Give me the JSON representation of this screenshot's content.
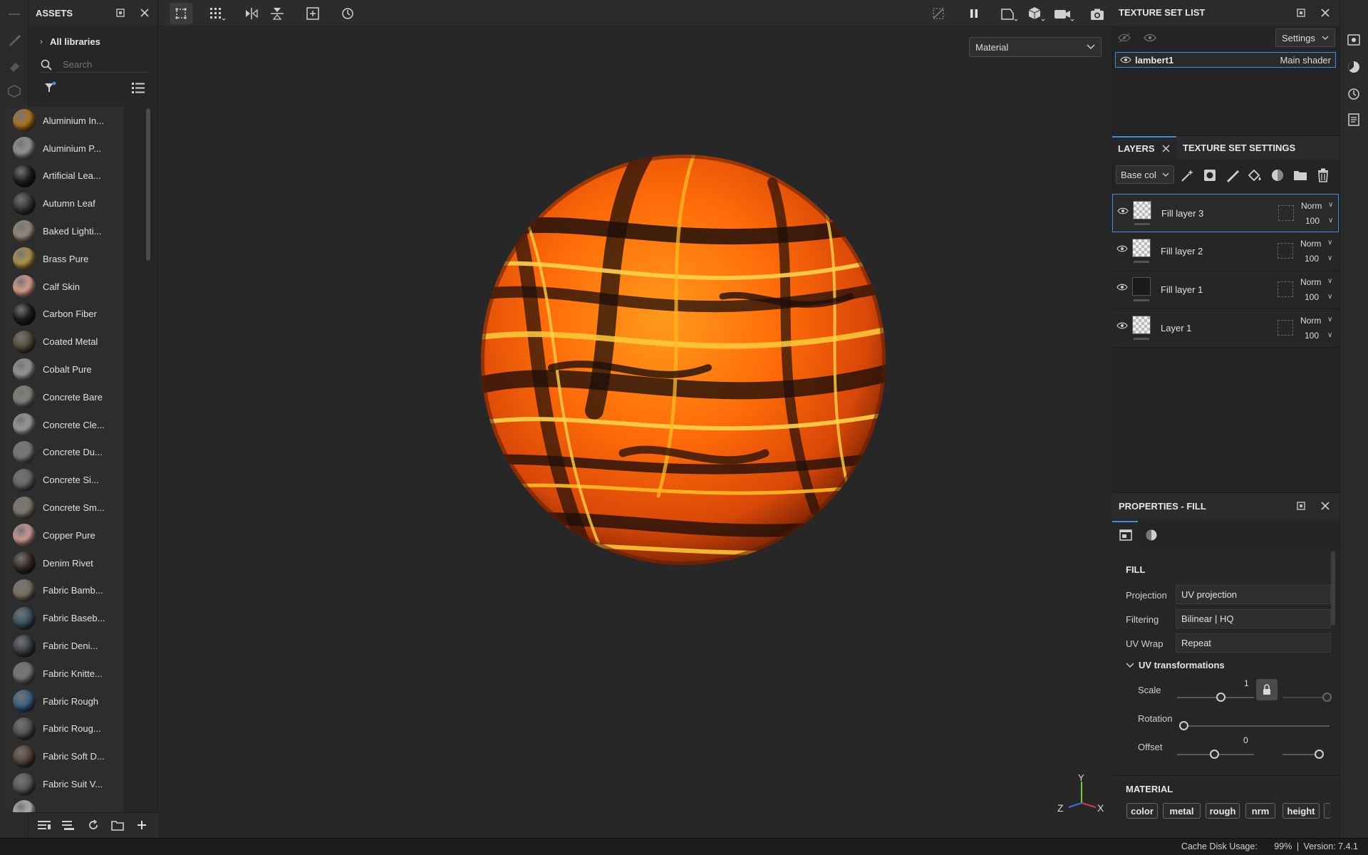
{
  "assets": {
    "title": "ASSETS",
    "all_libraries": "All libraries",
    "search_placeholder": "Search",
    "items": [
      {
        "label": "Aluminium In...",
        "color": "#b27a22"
      },
      {
        "label": "Aluminium P...",
        "color": "#9a9a9a"
      },
      {
        "label": "Artificial Lea...",
        "color": "#222222"
      },
      {
        "label": "Autumn Leaf",
        "color": "#3a3a3a"
      },
      {
        "label": "Baked Lighti...",
        "color": "#9c8f7e"
      },
      {
        "label": "Brass Pure",
        "color": "#b79a4a"
      },
      {
        "label": "Calf Skin",
        "color": "#e0a68f"
      },
      {
        "label": "Carbon Fiber",
        "color": "#1f1f1f"
      },
      {
        "label": "Coated Metal",
        "color": "#5a5040"
      },
      {
        "label": "Cobalt Pure",
        "color": "#9d9d9d"
      },
      {
        "label": "Concrete Bare",
        "color": "#8a8780"
      },
      {
        "label": "Concrete Cle...",
        "color": "#a2a2a2"
      },
      {
        "label": "Concrete Du...",
        "color": "#7c7c7c"
      },
      {
        "label": "Concrete Si...",
        "color": "#6a6a6a"
      },
      {
        "label": "Concrete Sm...",
        "color": "#857c70"
      },
      {
        "label": "Copper Pure",
        "color": "#d5a39c"
      },
      {
        "label": "Denim Rivet",
        "color": "#3a2e26"
      },
      {
        "label": "Fabric Bamb...",
        "color": "#7e7663"
      },
      {
        "label": "Fabric Baseb...",
        "color": "#3b5866"
      },
      {
        "label": "Fabric Deni...",
        "color": "#3d4248"
      },
      {
        "label": "Fabric Knitte...",
        "color": "#7a7a7a"
      },
      {
        "label": "Fabric Rough",
        "color": "#3d6585"
      },
      {
        "label": "Fabric Roug...",
        "color": "#555555"
      },
      {
        "label": "Fabric Soft D...",
        "color": "#5a4638"
      },
      {
        "label": "Fabric Suit V...",
        "color": "#5c5c5c"
      },
      {
        "label": "",
        "color": "#bdbdbd"
      }
    ]
  },
  "viewport": {
    "mode_select": "Material",
    "gizmo": {
      "x": "X",
      "y": "Y",
      "z": "Z"
    }
  },
  "texture_set_list": {
    "title": "TEXTURE SET LIST",
    "settings_label": "Settings",
    "item_name": "lambert1",
    "item_shader": "Main shader"
  },
  "layers": {
    "tab_layers": "LAYERS",
    "tab_texture_set_settings": "TEXTURE SET SETTINGS",
    "channel_select": "Base col",
    "rows": [
      {
        "name": "Fill layer 3",
        "blend": "Norm",
        "opacity": "100"
      },
      {
        "name": "Fill layer 2",
        "blend": "Norm",
        "opacity": "100"
      },
      {
        "name": "Fill layer 1",
        "blend": "Norm",
        "opacity": "100"
      },
      {
        "name": "Layer 1",
        "blend": "Norm",
        "opacity": "100"
      }
    ]
  },
  "properties": {
    "title": "PROPERTIES - FILL",
    "fill_section": "FILL",
    "projection_label": "Projection",
    "projection_value": "UV projection",
    "filtering_label": "Filtering",
    "filtering_value": "Bilinear | HQ",
    "uvwrap_label": "UV Wrap",
    "uvwrap_value": "Repeat",
    "uv_transformations": "UV transformations",
    "scale_label": "Scale",
    "scale_value": "1",
    "rotation_label": "Rotation",
    "offset_label": "Offset",
    "offset_value": "0",
    "material_section": "MATERIAL",
    "channels": [
      "color",
      "metal",
      "rough",
      "nrm",
      "height"
    ]
  },
  "status": {
    "cache_label": "Cache Disk Usage:",
    "cache_value": "99%",
    "version": "Version: 7.4.1"
  },
  "colors": {
    "accent": "#3a8ee6",
    "lava_light": "#ffb21f",
    "lava_mid": "#ff6a00",
    "lava_dark": "#1e0f0a"
  }
}
